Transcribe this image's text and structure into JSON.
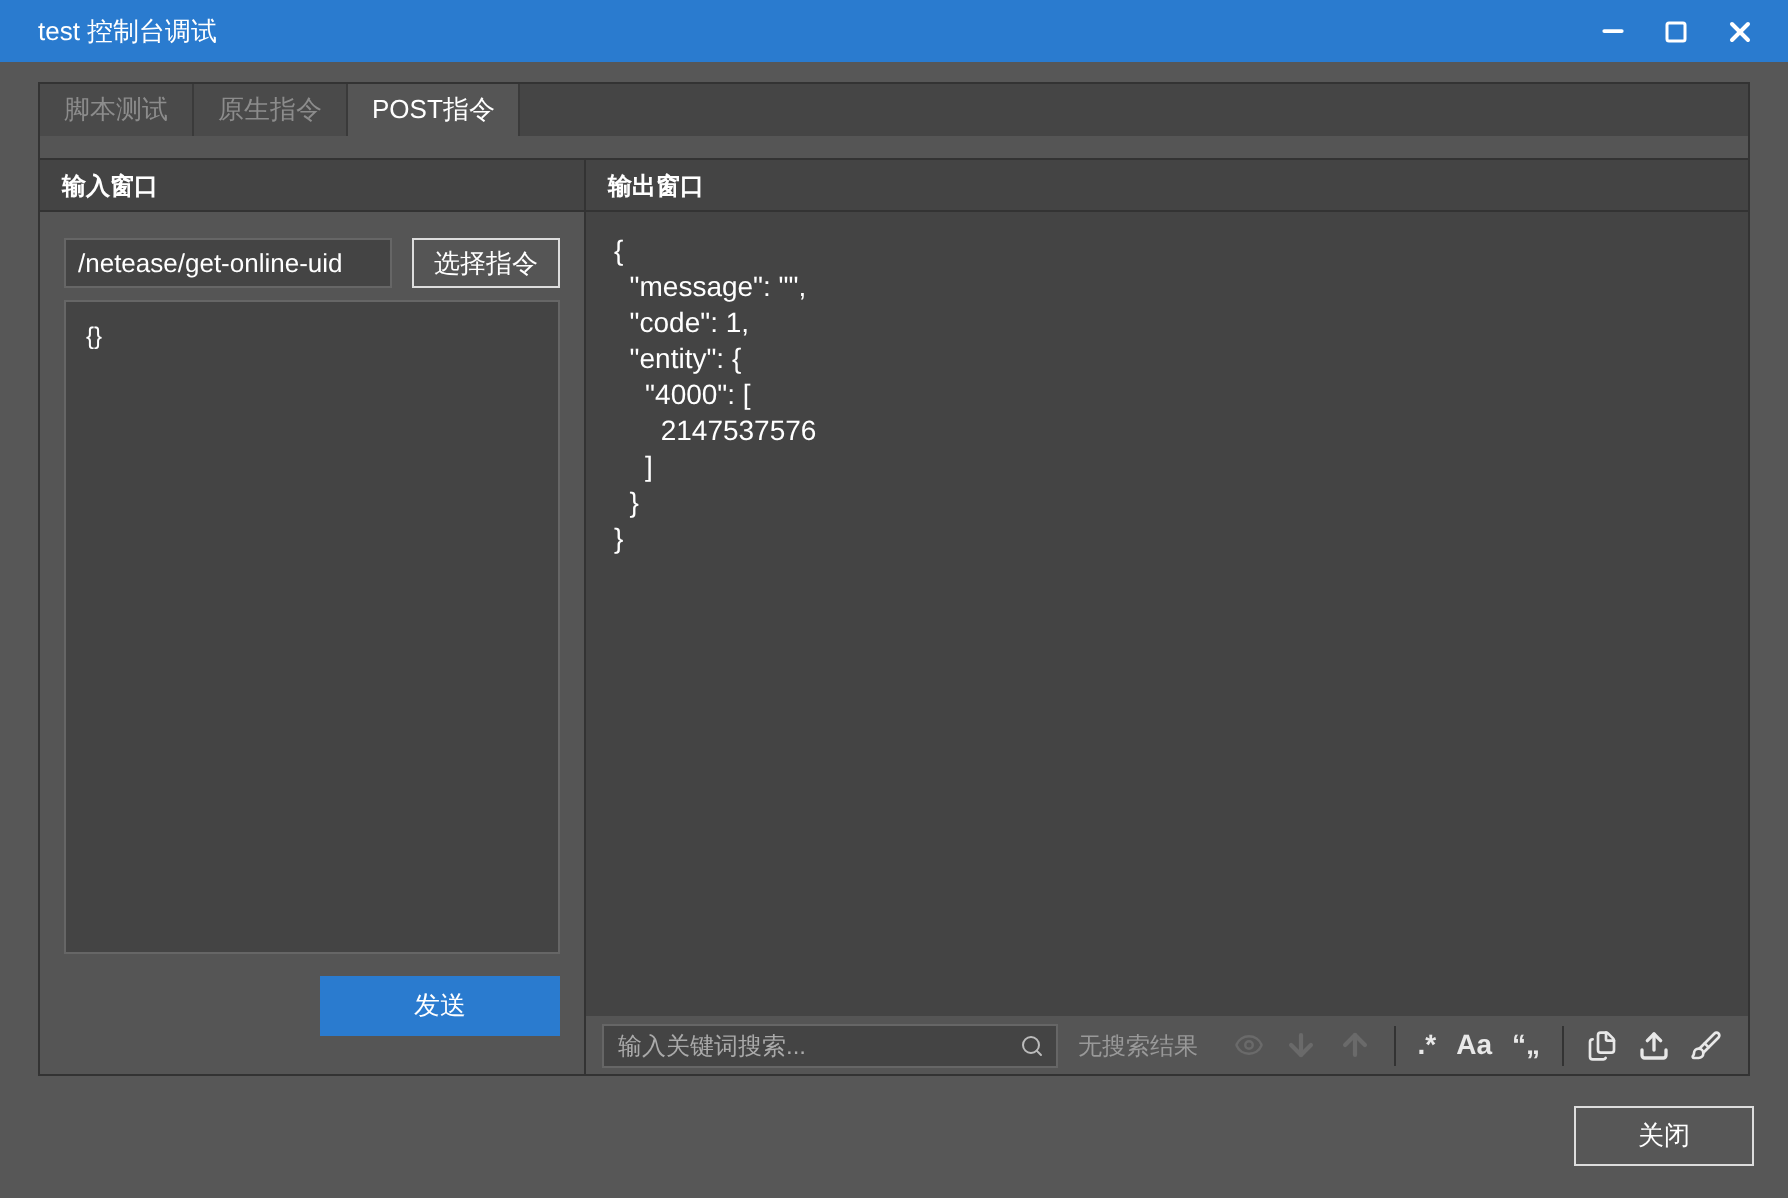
{
  "window": {
    "title": "test 控制台调试"
  },
  "tabs": [
    {
      "label": "脚本测试",
      "selected": false
    },
    {
      "label": "原生指令",
      "selected": false
    },
    {
      "label": "POST指令",
      "selected": true
    }
  ],
  "input_panel": {
    "title": "输入窗口",
    "path_value": "/netease/get-online-uid",
    "select_button": "选择指令",
    "body_value": "{}",
    "send_button": "发送"
  },
  "output_panel": {
    "title": "输出窗口",
    "lines": [
      "{",
      "  \"message\": \"\",",
      "  \"code\": 1,",
      "  \"entity\": {",
      "    \"4000\": [",
      "      2147537576",
      "    ]",
      "  }",
      "}"
    ]
  },
  "search": {
    "placeholder": "输入关键词搜索...",
    "result": "无搜索结果"
  },
  "toolbar": [
    {
      "kind": "eye",
      "disabled": true
    },
    {
      "kind": "down",
      "disabled": true
    },
    {
      "kind": "up",
      "disabled": true
    },
    {
      "kind": "sep"
    },
    {
      "kind": "text",
      "label": ".*",
      "disabled": false
    },
    {
      "kind": "text",
      "label": "Aa",
      "disabled": false
    },
    {
      "kind": "text",
      "label": "“„",
      "disabled": false
    },
    {
      "kind": "sep"
    },
    {
      "kind": "copy",
      "disabled": false
    },
    {
      "kind": "export",
      "disabled": false
    },
    {
      "kind": "clear",
      "disabled": false
    }
  ],
  "close_button": "关闭"
}
